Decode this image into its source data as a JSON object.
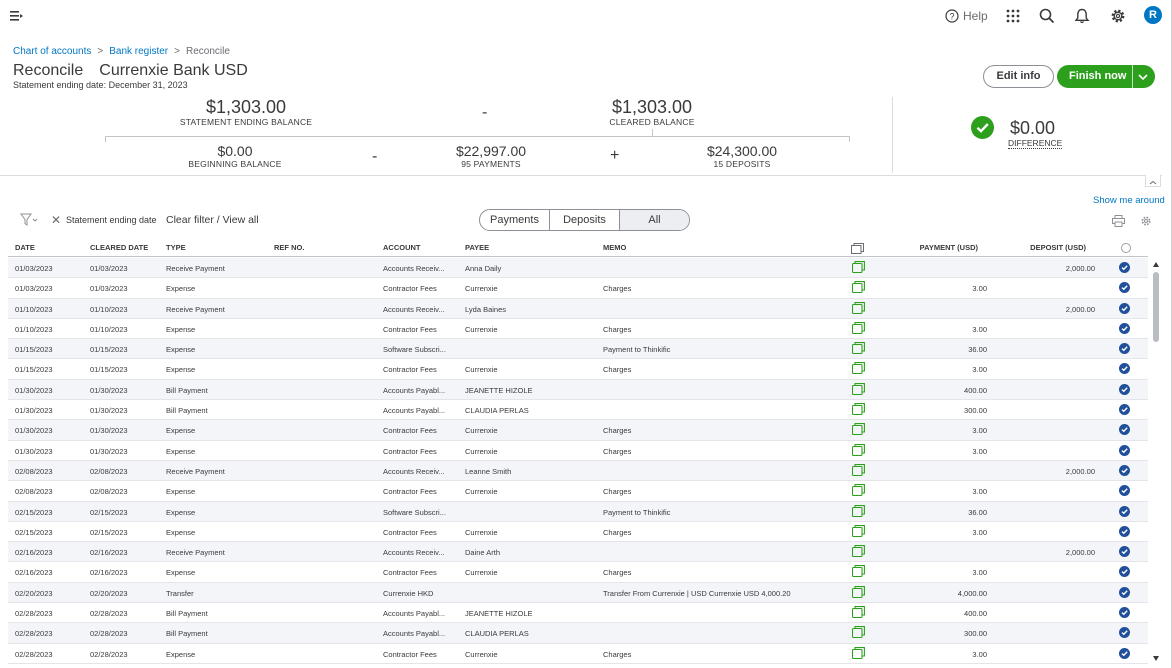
{
  "topbar": {
    "help_label": "Help",
    "avatar_initial": "R"
  },
  "breadcrumb": [
    "Chart of accounts",
    "Bank register",
    "Reconcile"
  ],
  "header": {
    "title": "Reconcile",
    "account": "Currenxie Bank USD",
    "statement_date": "Statement ending date: December 31, 2023",
    "edit_info": "Edit info",
    "finish_now": "Finish now"
  },
  "summary": {
    "statement_ending_balance": "$1,303.00",
    "statement_ending_balance_label": "STATEMENT ENDING BALANCE",
    "cleared_balance": "$1,303.00",
    "cleared_balance_label": "CLEARED BALANCE",
    "beginning_balance": "$0.00",
    "beginning_balance_label": "BEGINNING BALANCE",
    "payments": "$22,997.00",
    "payments_label": "95 PAYMENTS",
    "deposits": "$24,300.00",
    "deposits_label": "15 DEPOSITS",
    "difference": "$0.00",
    "difference_label": "DIFFERENCE",
    "op_minus": "-",
    "op_plus": "+"
  },
  "toolbar": {
    "show_me_around": "Show me around",
    "filter_label": "Statement ending date",
    "clear_filter": "Clear filter / View all",
    "tabs": [
      "Payments",
      "Deposits",
      "All"
    ],
    "active_tab": "All"
  },
  "table": {
    "columns": [
      "DATE",
      "CLEARED DATE",
      "TYPE",
      "REF NO.",
      "ACCOUNT",
      "PAYEE",
      "MEMO",
      "PAYMENT (USD)",
      "DEPOSIT (USD)"
    ],
    "rows": [
      [
        "01/03/2023",
        "01/03/2023",
        "Receive Payment",
        "",
        "Accounts Receiv...",
        "Anna Daily",
        "",
        "",
        "2,000.00"
      ],
      [
        "01/03/2023",
        "01/03/2023",
        "Expense",
        "",
        "Contractor Fees",
        "Currenxie",
        "Charges",
        "3.00",
        ""
      ],
      [
        "01/10/2023",
        "01/10/2023",
        "Receive Payment",
        "",
        "Accounts Receiv...",
        "Lyda Baines",
        "",
        "",
        "2,000.00"
      ],
      [
        "01/10/2023",
        "01/10/2023",
        "Expense",
        "",
        "Contractor Fees",
        "Currenxie",
        "Charges",
        "3.00",
        ""
      ],
      [
        "01/15/2023",
        "01/15/2023",
        "Expense",
        "",
        "Software Subscri...",
        "",
        "Payment to Thinkific",
        "36.00",
        ""
      ],
      [
        "01/15/2023",
        "01/15/2023",
        "Expense",
        "",
        "Contractor Fees",
        "Currenxie",
        "Charges",
        "3.00",
        ""
      ],
      [
        "01/30/2023",
        "01/30/2023",
        "Bill Payment",
        "",
        "Accounts Payabl...",
        "JEANETTE HIZOLE",
        "",
        "400.00",
        ""
      ],
      [
        "01/30/2023",
        "01/30/2023",
        "Bill Payment",
        "",
        "Accounts Payabl...",
        "CLAUDIA PERLAS",
        "",
        "300.00",
        ""
      ],
      [
        "01/30/2023",
        "01/30/2023",
        "Expense",
        "",
        "Contractor Fees",
        "Currenxie",
        "Charges",
        "3.00",
        ""
      ],
      [
        "01/30/2023",
        "01/30/2023",
        "Expense",
        "",
        "Contractor Fees",
        "Currenxie",
        "Charges",
        "3.00",
        ""
      ],
      [
        "02/08/2023",
        "02/08/2023",
        "Receive Payment",
        "",
        "Accounts Receiv...",
        "Leanne Smith",
        "",
        "",
        "2,000.00"
      ],
      [
        "02/08/2023",
        "02/08/2023",
        "Expense",
        "",
        "Contractor Fees",
        "Currenxie",
        "Charges",
        "3.00",
        ""
      ],
      [
        "02/15/2023",
        "02/15/2023",
        "Expense",
        "",
        "Software Subscri...",
        "",
        "Payment to Thinkific",
        "36.00",
        ""
      ],
      [
        "02/15/2023",
        "02/15/2023",
        "Expense",
        "",
        "Contractor Fees",
        "Currenxie",
        "Charges",
        "3.00",
        ""
      ],
      [
        "02/16/2023",
        "02/16/2023",
        "Receive Payment",
        "",
        "Accounts Receiv...",
        "Daine Arth",
        "",
        "",
        "2,000.00"
      ],
      [
        "02/16/2023",
        "02/16/2023",
        "Expense",
        "",
        "Contractor Fees",
        "Currenxie",
        "Charges",
        "3.00",
        ""
      ],
      [
        "02/20/2023",
        "02/20/2023",
        "Transfer",
        "",
        "Currenxie HKD",
        "",
        "Transfer From Currenxie | USD Currenxie USD 4,000.20",
        "4,000.00",
        ""
      ],
      [
        "02/28/2023",
        "02/28/2023",
        "Bill Payment",
        "",
        "Accounts Payabl...",
        "JEANETTE HIZOLE",
        "",
        "400.00",
        ""
      ],
      [
        "02/28/2023",
        "02/28/2023",
        "Bill Payment",
        "",
        "Accounts Payabl...",
        "CLAUDIA PERLAS",
        "",
        "300.00",
        ""
      ],
      [
        "02/28/2023",
        "02/28/2023",
        "Expense",
        "",
        "Contractor Fees",
        "Currenxie",
        "Charges",
        "3.00",
        ""
      ]
    ]
  },
  "colors": {
    "accent_green": "#2ca01c",
    "link_blue": "#0077c5",
    "check_blue": "#21509a"
  },
  "icons": [
    "menu-icon",
    "help-icon",
    "apps-grid-icon",
    "search-icon",
    "bell-icon",
    "gear-icon",
    "chevron-down-icon",
    "check-icon",
    "filter-icon",
    "close-icon",
    "print-icon",
    "document-icon",
    "cleared-check-icon"
  ]
}
